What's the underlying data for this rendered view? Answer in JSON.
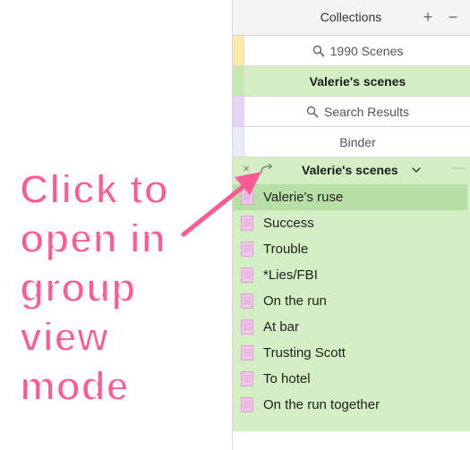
{
  "collections": {
    "title": "Collections",
    "add_label": "+",
    "remove_label": "−",
    "tabs": [
      {
        "label": "1990 Scenes",
        "icon": "search-icon",
        "color": "#fbe9a6"
      },
      {
        "label": "Valerie's scenes",
        "icon": "",
        "color": "#c5e8b0"
      },
      {
        "label": "Search Results",
        "icon": "search-icon",
        "color": "#e6d4f5"
      },
      {
        "label": "Binder",
        "icon": "",
        "color": "#e8eef8"
      }
    ]
  },
  "active_collection": {
    "close_label": "×",
    "title": "Valerie's scenes",
    "minus_label": "—",
    "background": "#d4efc4",
    "documents": [
      {
        "label": "Valerie's ruse",
        "selected": true
      },
      {
        "label": "Success"
      },
      {
        "label": "Trouble"
      },
      {
        "label": "*Lies/FBI"
      },
      {
        "label": "On the run"
      },
      {
        "label": "At bar"
      },
      {
        "label": "Trusting Scott"
      },
      {
        "label": "To hotel"
      },
      {
        "label": "On the run together"
      }
    ]
  },
  "callout": {
    "lines": [
      "Click to",
      "open in",
      "group",
      "view",
      "mode"
    ],
    "color": "#ff5a93"
  }
}
